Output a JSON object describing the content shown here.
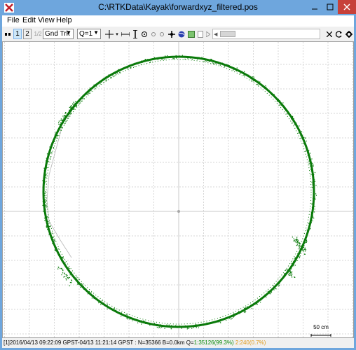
{
  "window": {
    "title": "C:\\RTKData\\Kayak\\forwardxyz_filtered.pos",
    "min_icon": "minimize-icon",
    "max_icon": "maximize-icon",
    "close_icon": "close-icon"
  },
  "menu": {
    "file": "File",
    "edit": "Edit",
    "view": "View",
    "help": "Help"
  },
  "toolbar": {
    "btn1": "1",
    "btn2": "2",
    "btn12": "1/2",
    "plot_type": "Gnd Trk",
    "quality": "Q=1",
    "accent": "#0a7a0a"
  },
  "plot": {
    "scale_label": "50 cm",
    "track_color": "#0a7a0a",
    "q2_color": "#e09a1a"
  },
  "status": {
    "prefix": "[1]2016/04/13 09:22:09 GPST-04/13 11:21:14 GPST : N=35366 B=0.0km Q=",
    "q1": "1:35126(99.3%)",
    "q2": "2:240(0.7%)"
  }
}
